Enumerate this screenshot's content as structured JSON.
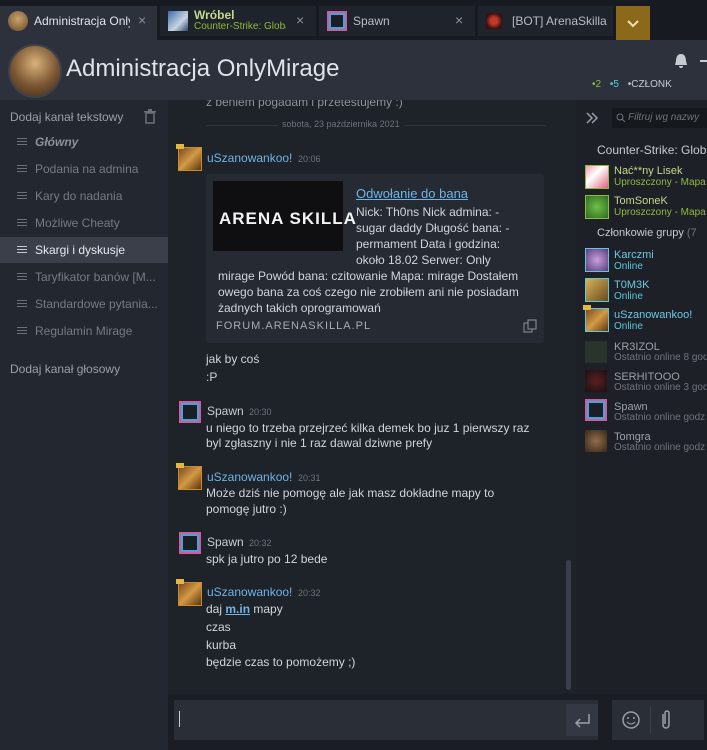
{
  "tabs": [
    {
      "title": "Administracja OnlyMirage",
      "close": "×"
    },
    {
      "title": "Wróbel",
      "subtitle": "Counter-Strike: Global Offensive",
      "close": "×"
    },
    {
      "title": "Spawn",
      "close": "×"
    },
    {
      "title": "[BOT] ArenaSkilla",
      "close": "×"
    }
  ],
  "header": {
    "group_title": "Administracja OnlyMirage",
    "count_ingame": "2",
    "count_online": "5",
    "members_label": "CZŁONK"
  },
  "sidebar": {
    "add_text_channel": "Dodaj kanał tekstowy",
    "add_voice_channel": "Dodaj kanał głosowy",
    "channels": [
      "Główny",
      "Podania na admina",
      "Kary do nadania",
      "Możliwe Cheaty",
      "Skargi i dyskusje",
      "Taryfikator banów [M...",
      "Standardowe pytania...",
      "Regulamin Mirage"
    ]
  },
  "chat": {
    "top_partial": "z beniem pogadam i przetestujemy :)",
    "date_divider": "sobota, 23 października 2021",
    "messages": [
      {
        "user": "uSzanowankoo!",
        "time": "20:06",
        "embed": {
          "image_text": "ARENA SKILLA",
          "link": "Odwołanie do bana",
          "lines": [
            "Nick: Th0ns Nick admina: -",
            "sugar daddy Długość bana: -",
            "permament Data i godzina:",
            "około 18.02 Serwer: Only"
          ],
          "wide_lines": [
            "mirage Powód bana: czitowanie Mapa: mirage Dostałem",
            "owego bana za coś czego nie zrobiłem ani nie posiadam",
            "żadnych takich oprogramowań"
          ],
          "domain": "FORUM.ARENASKILLA.PL"
        },
        "lines": [
          "jak by coś",
          ":P"
        ]
      },
      {
        "user": "Spawn",
        "time": "20:30",
        "lines": [
          "u niego to trzeba przejrzeć kilka demek bo juz 1 pierwszy raz",
          "byl zgłaszny i nie 1 raz dawal dziwne prefy"
        ]
      },
      {
        "user": "uSzanowankoo!",
        "time": "20:31",
        "lines": [
          "Może dziś nie pomogę ale jak masz dokładne mapy to",
          "pomogę jutro :)"
        ]
      },
      {
        "user": "Spawn",
        "time": "20:32",
        "lines": [
          "spk ja jutro po 12 bede"
        ]
      },
      {
        "user": "uSzanowankoo!",
        "time": "20:32",
        "lines": [
          "mapy",
          "czas",
          "kurba",
          "będzie czas to pomożemy ;)"
        ],
        "link_word": "m.in",
        "prefix_word": "daj"
      }
    ]
  },
  "members": {
    "filter_placeholder": "Filtruj wg nazwy",
    "game_group": "Counter-Strike: Glob",
    "in_game": [
      {
        "name": "Nać**ny Lisek",
        "status": "Uproszczony - Mapa"
      },
      {
        "name": "TomSoneK",
        "status": "Uproszczony - Mapa"
      }
    ],
    "group_members_label": "Członkowie grupy",
    "group_members_count": "(7",
    "list": [
      {
        "name": "Karczmi",
        "status": "Online"
      },
      {
        "name": "T0M3K",
        "status": "Online"
      },
      {
        "name": "uSzanowankoo!",
        "status": "Online"
      },
      {
        "name": "KR3IZOL",
        "status": "Ostatnio online 8 god"
      },
      {
        "name": "SERHITOOO",
        "status": "Ostatnio online 3 god"
      },
      {
        "name": "Spawn",
        "status": "Ostatnio online godz"
      },
      {
        "name": "Tomgra",
        "status": "Ostatnio online godz"
      }
    ]
  },
  "colors": {
    "accent": "#6fb4e8",
    "ingame": "#90ba3c",
    "online": "#57cbde",
    "offline": "#6e737c"
  }
}
